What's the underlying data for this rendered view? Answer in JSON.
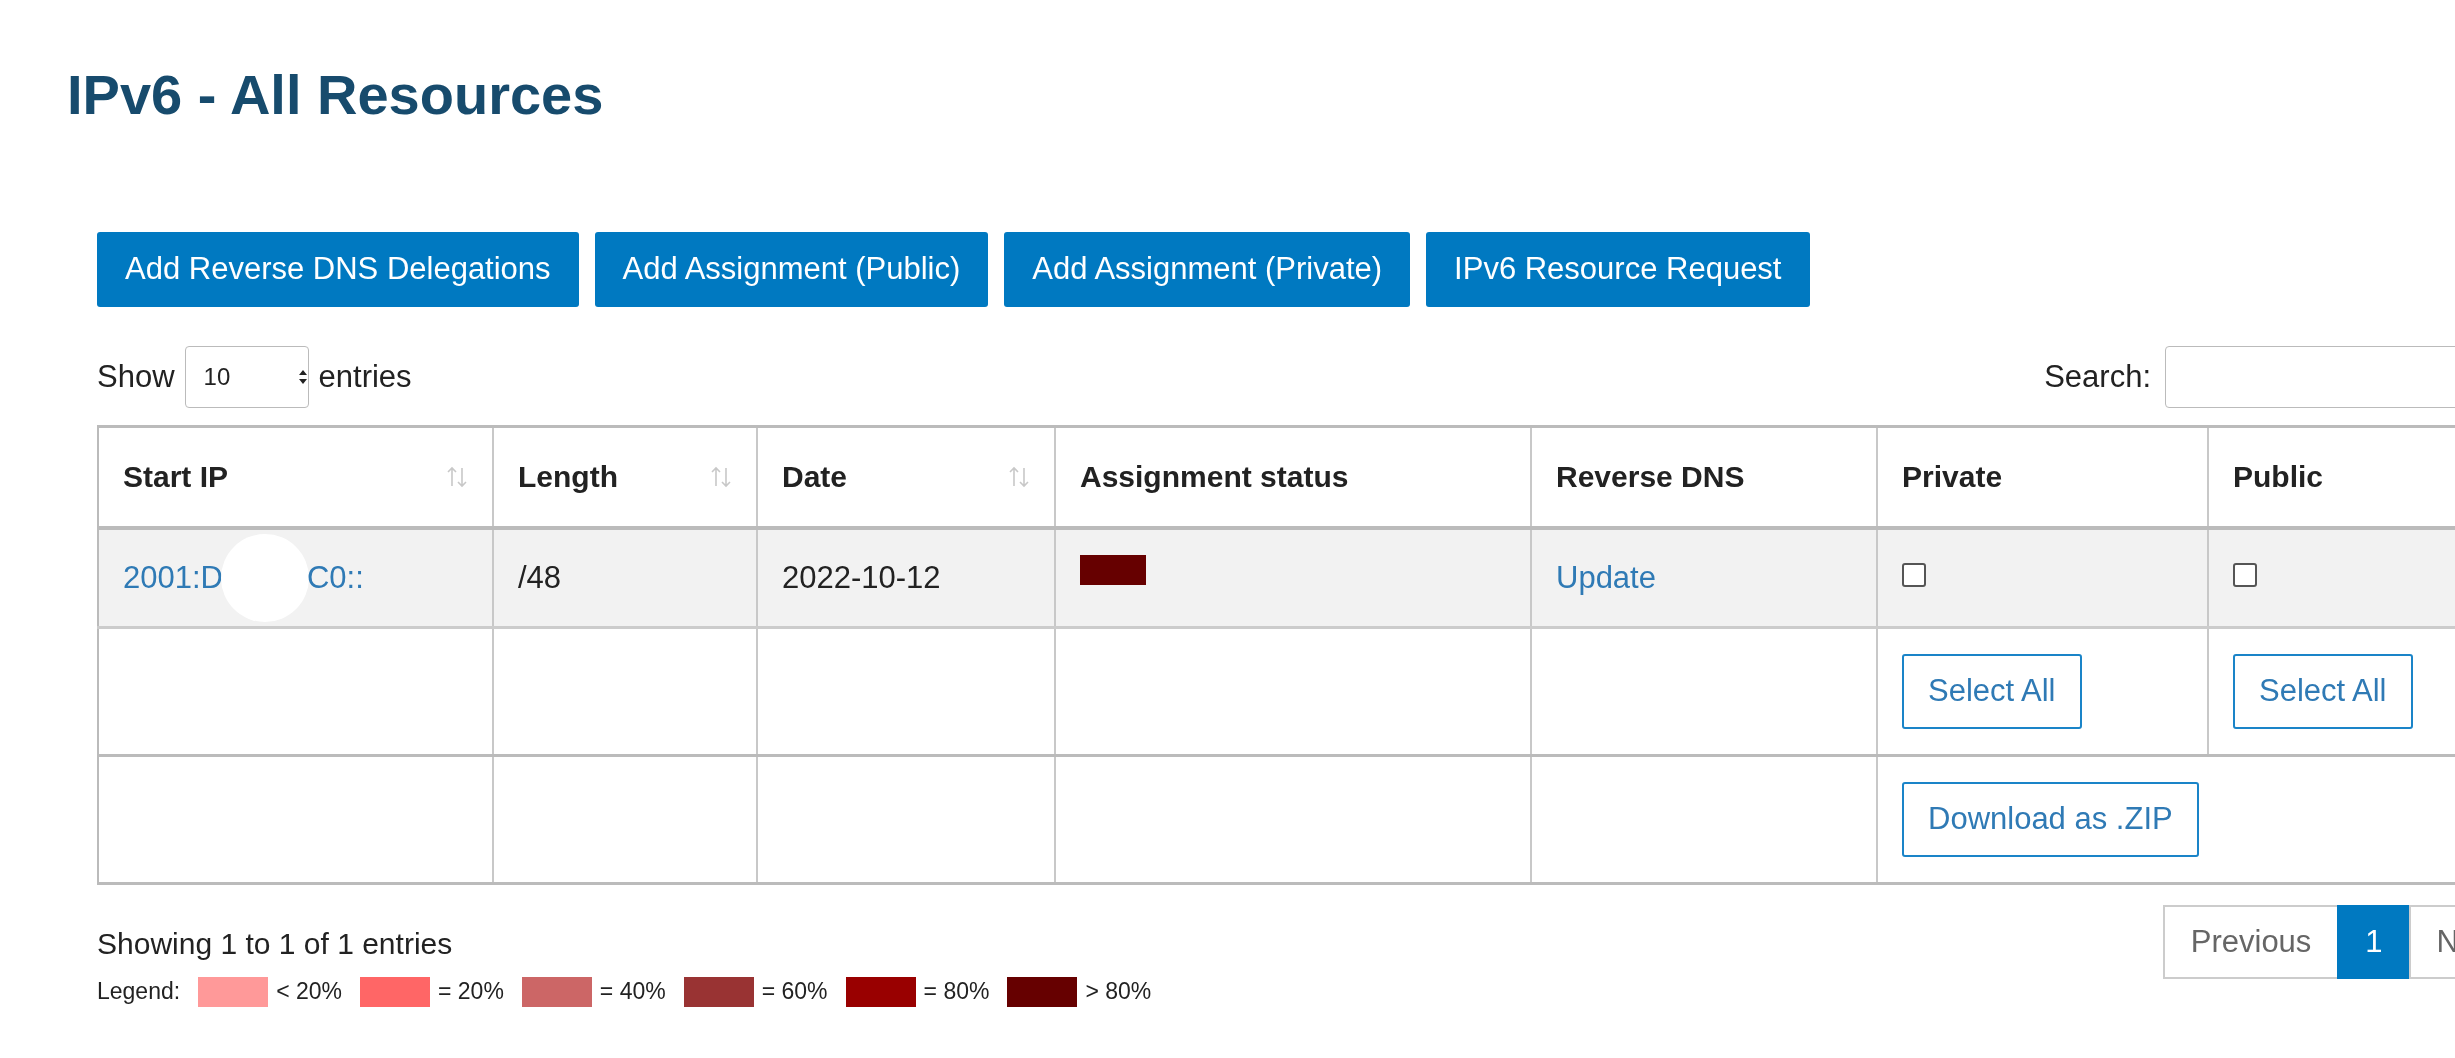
{
  "title": "IPv6 - All Resources",
  "actions": [
    "Add Reverse DNS Delegations",
    "Add Assignment (Public)",
    "Add Assignment (Private)",
    "IPv6 Resource Request"
  ],
  "length_menu": {
    "before": "Show",
    "value": "10",
    "after": "entries"
  },
  "search": {
    "label": "Search:"
  },
  "table": {
    "columns": [
      {
        "label": "Start IP",
        "sortable": true
      },
      {
        "label": "Length",
        "sortable": true
      },
      {
        "label": "Date",
        "sortable": true
      },
      {
        "label": "Assignment status",
        "sortable": false
      },
      {
        "label": "Reverse DNS",
        "sortable": false
      },
      {
        "label": "Private",
        "sortable": false
      },
      {
        "label": "Public",
        "sortable": false
      }
    ],
    "rows": [
      {
        "start_ip_start": "2001:D",
        "start_ip_end": "C0::",
        "redacted": true,
        "length": "/48",
        "date": "2022-10-12",
        "color": "#660000",
        "reverse_dns": "Update",
        "private_checked": false,
        "public_checked": false
      }
    ],
    "select_all": [
      "Select All",
      "Select All"
    ],
    "download": "Download as .ZIP"
  },
  "info": "Showing 1 to 1 of 1 entries",
  "pagination": [
    {
      "label": "Previous",
      "selected": false
    },
    {
      "label": "1",
      "selected": true
    },
    {
      "label": "N",
      "selected": false
    }
  ],
  "legend": {
    "label": "Legend:",
    "items": [
      {
        "color": "#ff9999",
        "label": "< 20%"
      },
      {
        "color": "#ff6666",
        "label": "= 20%"
      },
      {
        "color": "#cc6666",
        "label": "= 40%"
      },
      {
        "color": "#993333",
        "label": "= 60%"
      },
      {
        "color": "#990000",
        "label": "= 80%"
      },
      {
        "color": "#660000",
        "label": "> 80%"
      }
    ]
  }
}
